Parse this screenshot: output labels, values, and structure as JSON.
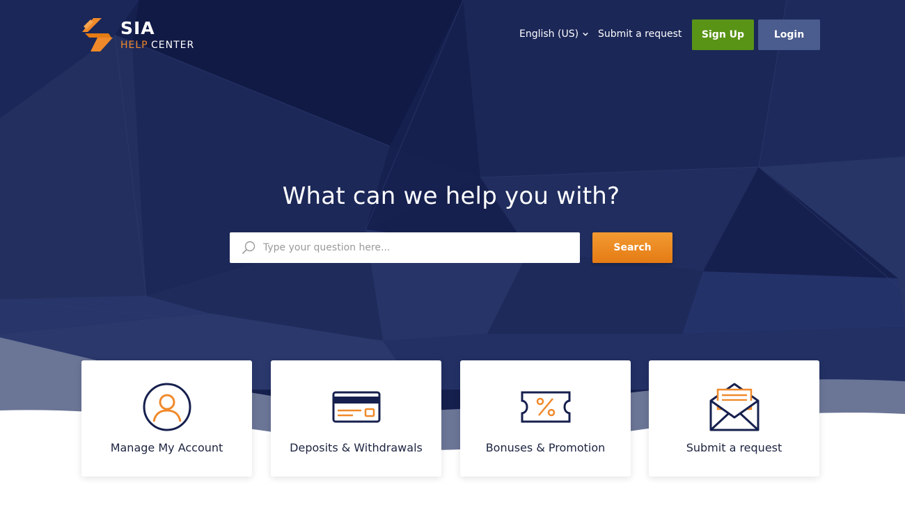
{
  "colors": {
    "hero_bg": "#16204e",
    "accent_orange": "#f0892a",
    "signup_green": "#5a9417",
    "login_blue": "#4b5c8e",
    "icon_navy": "#16204e"
  },
  "brand": {
    "name": "SIA",
    "sub_help": "HELP",
    "sub_center": "CENTER",
    "icon": "sia-logo-mark"
  },
  "header": {
    "language": "English (US)",
    "language_icon": "chevron-down-icon",
    "submit_request": "Submit a request",
    "signup": "Sign Up",
    "login": "Login"
  },
  "hero": {
    "headline": "What can we help you with?",
    "search": {
      "placeholder": "Type your question here...",
      "value": "",
      "icon": "search-icon",
      "button": "Search"
    }
  },
  "categories": [
    {
      "label": "Manage My Account",
      "icon": "user-account-icon"
    },
    {
      "label": "Deposits & Withdrawals",
      "icon": "credit-card-icon"
    },
    {
      "label": "Bonuses & Promotion",
      "icon": "coupon-percent-icon"
    },
    {
      "label": "Submit a request",
      "icon": "envelope-icon"
    }
  ]
}
